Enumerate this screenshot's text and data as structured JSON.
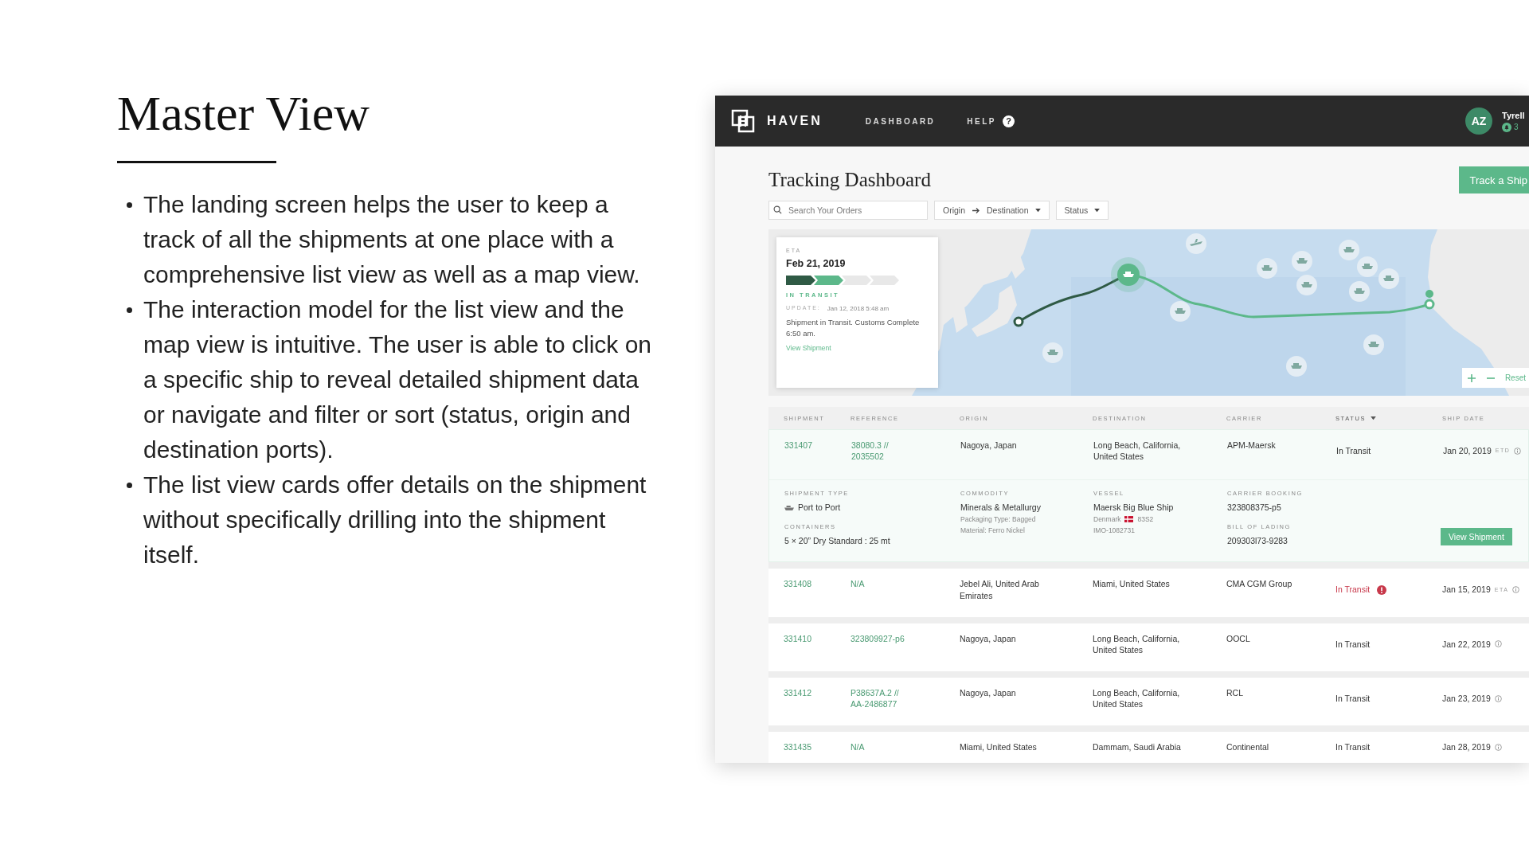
{
  "slide": {
    "title": "Master View",
    "bullets": [
      "The landing screen helps the user to keep a track of all the shipments at one place with a comprehensive list view as well as a map view.",
      "The interaction model for the list view and the map view is intuitive. The user is able to click on a specific ship to reveal detailed shipment data or navigate and filter or sort (status, origin and destination ports).",
      "The list view cards offer details on the shipment without specifically drilling into the shipment itself."
    ]
  },
  "app": {
    "brand": "HAVEN",
    "nav": [
      {
        "label": "DASHBOARD"
      },
      {
        "label": "HELP",
        "badge": "?"
      }
    ],
    "user": {
      "initials": "AZ",
      "name": "Tyrell",
      "notifications": "3"
    },
    "page_title": "Tracking Dashboard",
    "primary_button": "Track a Ship",
    "search": {
      "placeholder": "Search Your Orders"
    },
    "filters": {
      "origin": "Origin",
      "destination": "Destination",
      "status": "Status"
    },
    "map": {
      "popup": {
        "eta_label": "ETA",
        "eta": "Feb 21, 2019",
        "stages": [
          {
            "color": "#2f5a45"
          },
          {
            "color": "#5cb88a"
          },
          {
            "color": "#e8e8e8"
          },
          {
            "color": "#e8e8e8"
          }
        ],
        "status": "IN TRANSIT",
        "update_label": "UPDATE:",
        "update_time": "Jan 12, 2018 5:48 am",
        "message": "Shipment in Transit. Customs Complete 6:50 am.",
        "link": "View Shipment"
      },
      "reset": "Reset"
    },
    "table": {
      "columns": [
        {
          "label": "SHIPMENT",
          "sorted": false
        },
        {
          "label": "REFERENCE",
          "sorted": false
        },
        {
          "label": "ORIGIN",
          "sorted": false
        },
        {
          "label": "DESTINATION",
          "sorted": false
        },
        {
          "label": "CARRIER",
          "sorted": false
        },
        {
          "label": "STATUS",
          "sorted": true
        },
        {
          "label": "SHIP DATE",
          "sorted": false
        }
      ],
      "rows": [
        {
          "shipment": "331407",
          "reference": "38080.3 // 2035502",
          "origin": "Nagoya, Japan",
          "destination": "Long Beach, California, United States",
          "carrier": "APM-Maersk",
          "status": "In Transit",
          "alert": false,
          "ship_date": "Jan 20, 2019",
          "date_type": "ETD",
          "expanded": true,
          "details": {
            "shipment_type": {
              "label": "SHIPMENT TYPE",
              "value": "Port to Port"
            },
            "containers": {
              "label": "CONTAINERS",
              "value": "5 × 20” Dry Standard : 25 mt"
            },
            "commodity": {
              "label": "COMMODITY",
              "value": "Minerals & Metallurgy",
              "notes": [
                "Packaging Type: Bagged",
                "Material: Ferro Nickel"
              ]
            },
            "vessel": {
              "label": "VESSEL",
              "value": "Maersk Big Blue Ship",
              "country": "Denmark",
              "code": "83S2",
              "imo": "IMO-1082731"
            },
            "carrier_booking": {
              "label": "CARRIER BOOKING",
              "value": "323808375-p5"
            },
            "bill_of_lading": {
              "label": "BILL OF LADING",
              "value": "209303l73-9283"
            },
            "button": "View Shipment"
          }
        },
        {
          "shipment": "331408",
          "reference": "N/A",
          "origin": "Jebel Ali, United Arab Emirates",
          "destination": "Miami, United States",
          "carrier": "CMA CGM Group",
          "status": "In Transit",
          "alert": true,
          "ship_date": "Jan 15, 2019",
          "date_type": "ETA",
          "expanded": false
        },
        {
          "shipment": "331410",
          "reference": "323809927-p6",
          "origin": "Nagoya, Japan",
          "destination": "Long Beach, California, United States",
          "carrier": "OOCL",
          "status": "In Transit",
          "alert": false,
          "ship_date": "Jan 22, 2019",
          "expanded": false
        },
        {
          "shipment": "331412",
          "reference": "P38637A.2 // AA-2486877",
          "origin": "Nagoya, Japan",
          "destination": "Long Beach, California, United States",
          "carrier": "RCL",
          "status": "In Transit",
          "alert": false,
          "ship_date": "Jan 23, 2019",
          "expanded": false
        },
        {
          "shipment": "331435",
          "reference": "N/A",
          "origin": "Miami, United States",
          "destination": "Dammam, Saudi Arabia",
          "carrier": "Continental",
          "status": "In Transit",
          "alert": false,
          "ship_date": "Jan 28, 2019",
          "expanded": false
        }
      ]
    }
  }
}
